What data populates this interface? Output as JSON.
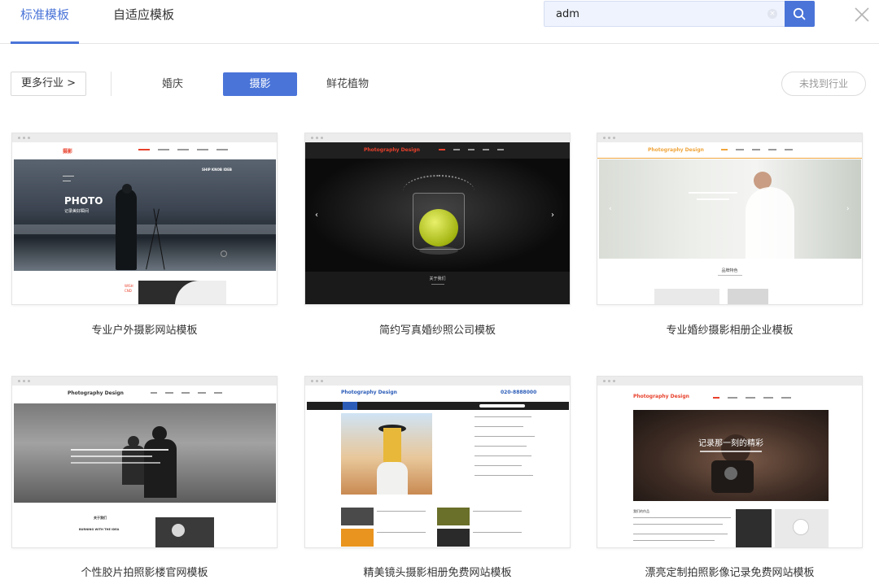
{
  "tabs": [
    {
      "label": "标准模板",
      "active": true
    },
    {
      "label": "自适应模板",
      "active": false
    }
  ],
  "search": {
    "value": "adm"
  },
  "filters": {
    "more_label": "更多行业 >",
    "categories": [
      {
        "label": "婚庆",
        "active": false
      },
      {
        "label": "摄影",
        "active": true
      },
      {
        "label": "鲜花植物",
        "active": false
      }
    ],
    "not_found_label": "未找到行业"
  },
  "templates": [
    {
      "title": "专业户外摄影网站模板",
      "preview": {
        "logo": "摄影",
        "hero_heading": "PHOTO",
        "hero_sub": "记录美好瞬间",
        "hero_tag": "SHIP KNOB IDEB",
        "side_text": "WISH\nCND"
      }
    },
    {
      "title": "简约写真婚纱照公司模板",
      "preview": {
        "logo": "Photography Design",
        "footer_label": "关于我们"
      }
    },
    {
      "title": "专业婚纱摄影相册企业模板",
      "preview": {
        "logo": "Photography Design",
        "section_label": "品牌特色"
      }
    },
    {
      "title": "个性胶片拍照影楼官网模板",
      "preview": {
        "logo": "Photography Design",
        "hero_caption": "BURNING WITH THE IDEA",
        "section_label": "关于我们"
      }
    },
    {
      "title": "精美镜头摄影相册免费网站模板",
      "preview": {
        "logo": "Photography Design",
        "phone": "020-8888000"
      }
    },
    {
      "title": "漂亮定制拍照影像记录免费网站模板",
      "preview": {
        "logo": "Photography Design",
        "hero_heading": "记录那一刻的精彩",
        "section_label": "我们的作品"
      }
    }
  ],
  "colors": {
    "accent": "#4a74d8",
    "brand_red": "#e8412c",
    "brand_orange": "#f0a53c"
  }
}
